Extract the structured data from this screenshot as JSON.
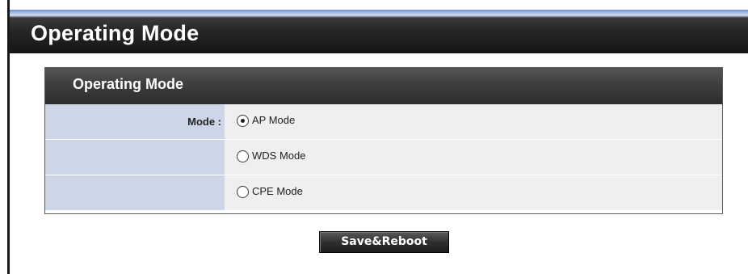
{
  "page": {
    "title": "Operating Mode"
  },
  "panel": {
    "title": "Operating Mode",
    "mode_label": "Mode :",
    "options": [
      {
        "label": "AP Mode",
        "checked": true
      },
      {
        "label": "WDS Mode",
        "checked": false
      },
      {
        "label": "CPE Mode",
        "checked": false
      }
    ]
  },
  "actions": {
    "save_reboot_label": "Save&Reboot"
  },
  "colors": {
    "header_dark": "#262626",
    "header_highlight": "#a9bfe4",
    "label_cell": "#ccd6e6",
    "value_cell": "#efefef"
  },
  "icons": {
    "radio_selected": "radio-selected-icon",
    "radio_unselected": "radio-unselected-icon"
  }
}
